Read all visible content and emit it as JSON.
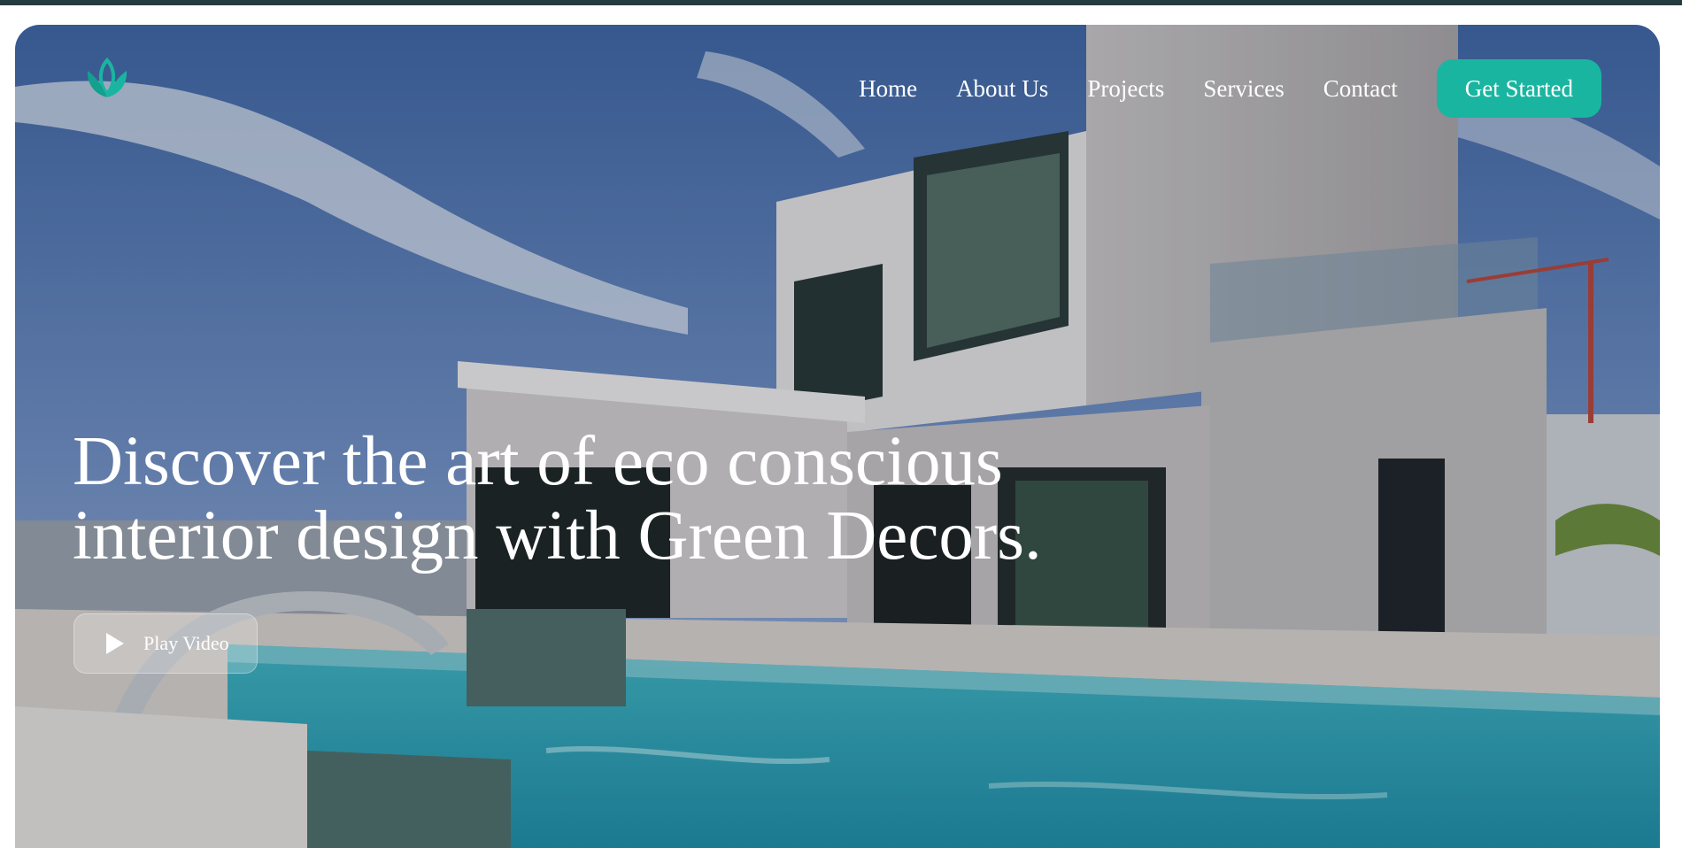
{
  "brand": {
    "logo_icon": "lotus-leaf-icon",
    "accent": "#1ab5a0"
  },
  "nav": {
    "items": [
      {
        "label": "Home"
      },
      {
        "label": "About Us"
      },
      {
        "label": "Projects"
      },
      {
        "label": "Services"
      },
      {
        "label": "Contact"
      }
    ],
    "cta_label": "Get Started"
  },
  "hero": {
    "headline_line1": "Discover the art of eco conscious",
    "headline_line2": "interior design with Green Decors.",
    "play_label": "Play Video",
    "play_icon": "play-icon"
  }
}
